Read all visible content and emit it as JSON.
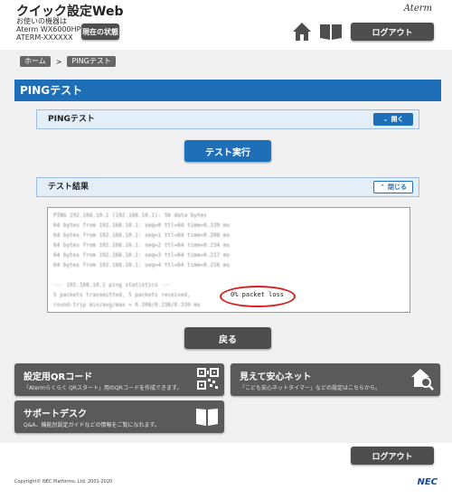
{
  "header": {
    "title": "クイック設定Web",
    "device_label": "お使いの機器は",
    "device_model": "Aterm WX6000HP",
    "device_id": "ATERM-XXXXXX",
    "status_button": "現在の状態",
    "brand": "Aterm",
    "logout_button": "ログアウト",
    "home_icon": "home-icon",
    "manual_icon": "book-icon"
  },
  "breadcrumb": {
    "items": [
      "ホーム",
      "PINGテスト"
    ],
    "separator": ">"
  },
  "page_title": "PINGテスト",
  "ping_panel": {
    "title": "PINGテスト",
    "toggle_label": "開く"
  },
  "run_button": "テスト実行",
  "result_panel": {
    "title": "テスト結果",
    "toggle_label": "閉じる"
  },
  "result_output": {
    "lines": [
      "PING 192.168.10.1 (192.168.10.1): 56 data bytes",
      "64 bytes from 192.168.10.1: seq=0 ttl=64 time=0.339 ms",
      "64 bytes from 192.168.10.1: seq=1 ttl=64 time=0.208 ms",
      "64 bytes from 192.168.10.1: seq=2 ttl=64 time=0.234 ms",
      "64 bytes from 192.168.10.1: seq=3 ttl=64 time=0.217 ms",
      "64 bytes from 192.168.10.1: seq=4 ttl=64 time=0.216 ms",
      "",
      "--- 192.168.10.1 ping statistics ---",
      "5 packets transmitted, 5 packets received,",
      "round-trip min/avg/max = 0.208/0.238/0.339 ms"
    ],
    "highlight": "0% packet loss"
  },
  "back_button": "戻る",
  "tiles": {
    "qr": {
      "title": "設定用QRコード",
      "desc": "「Atermらくらく QRスタート」用のQRコードを作成できます。",
      "icon": "qr-code-icon"
    },
    "safety": {
      "title": "見えて安心ネット",
      "desc": "「こども安心ネットタイマー」などの設定はこちらから。",
      "icon": "house-search-icon"
    },
    "support": {
      "title": "サポートデスク",
      "desc": "Q&A、機能別設定ガイドなどの情報をご覧になれます。",
      "icon": "book-icon"
    }
  },
  "footer": {
    "logout_button": "ログアウト",
    "copyright": "Copyright© NEC Platforms, Ltd. 2001-2020",
    "brand": "NEC"
  }
}
